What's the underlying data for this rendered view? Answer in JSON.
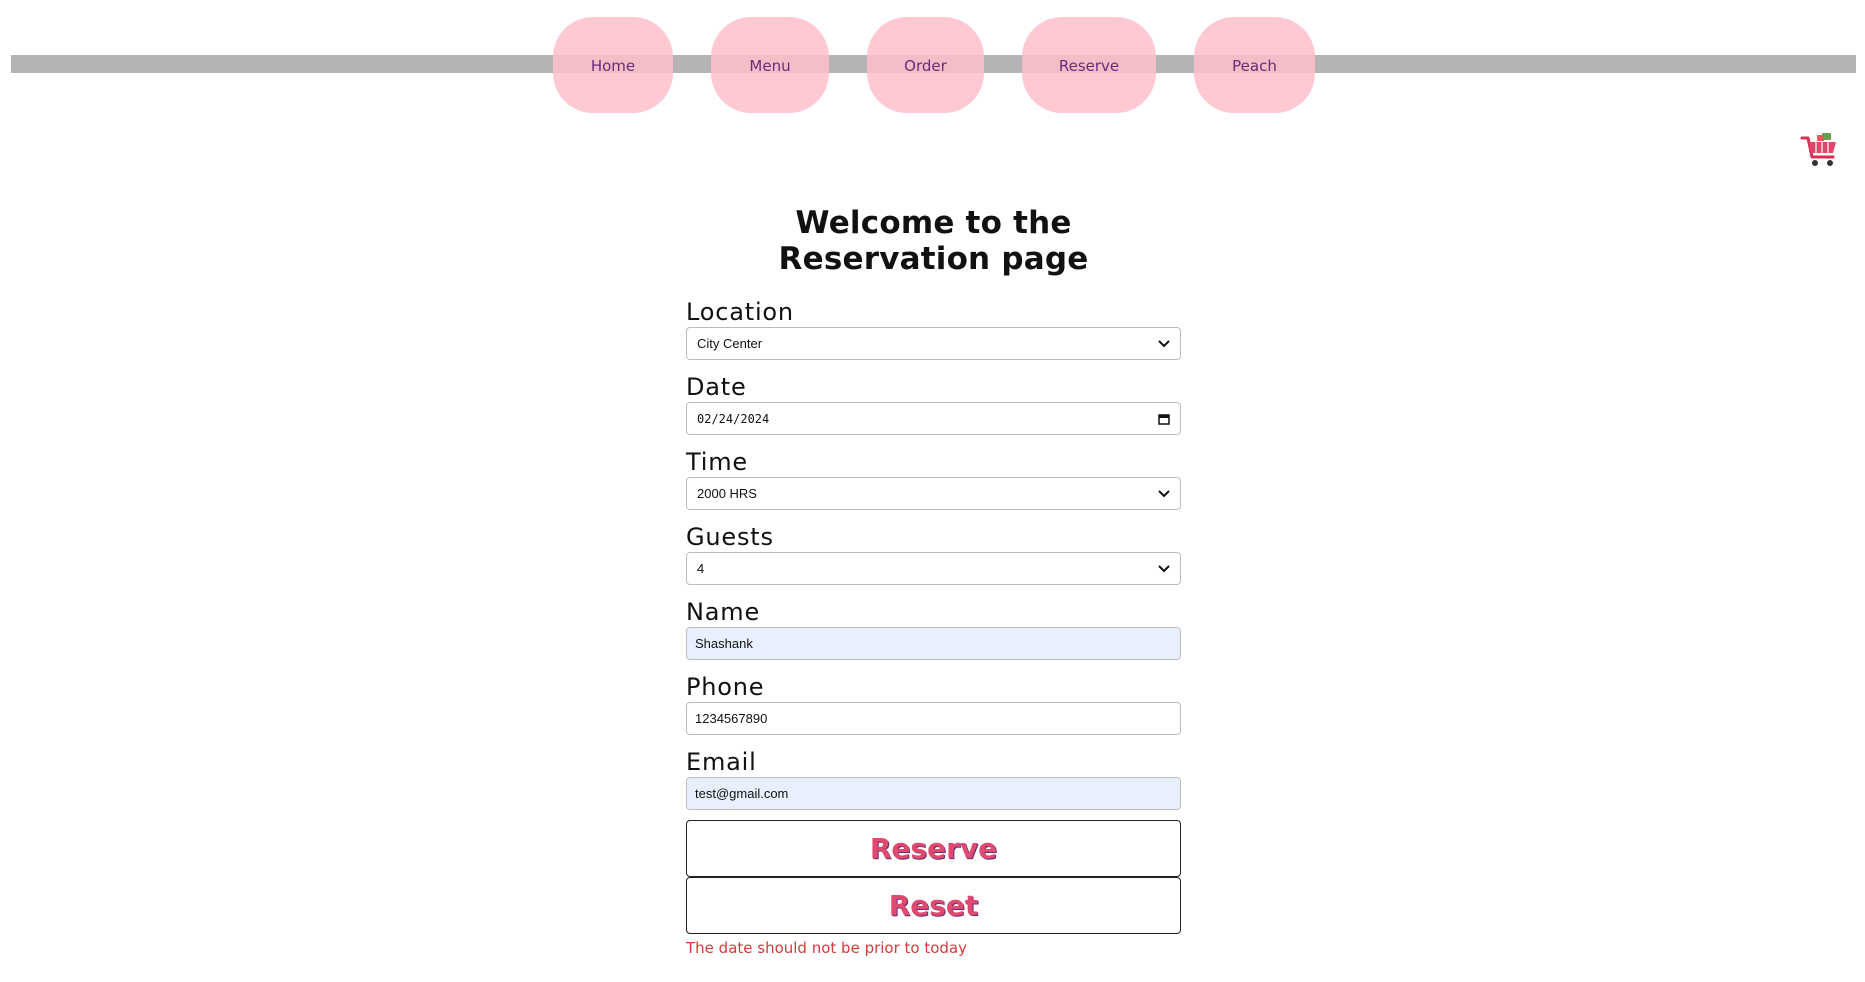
{
  "nav": {
    "items": [
      {
        "label": "Home"
      },
      {
        "label": "Menu"
      },
      {
        "label": "Order"
      },
      {
        "label": "Reserve"
      },
      {
        "label": "Peach"
      }
    ]
  },
  "cart": {
    "icon": "cart-icon"
  },
  "form": {
    "title": "Welcome to the Reservation page",
    "location": {
      "label": "Location",
      "value": "City Center"
    },
    "date": {
      "label": "Date",
      "value": "02/24/2024"
    },
    "time": {
      "label": "Time",
      "value": "2000 HRS"
    },
    "guests": {
      "label": "Guests",
      "value": "4"
    },
    "name": {
      "label": "Name",
      "value": "Shashank"
    },
    "phone": {
      "label": "Phone",
      "value": "1234567890"
    },
    "email": {
      "label": "Email",
      "value": "test@gmail.com"
    },
    "reserve_label": "Reserve",
    "reset_label": "Reset",
    "error": "The date should not be prior to today"
  },
  "colors": {
    "nav_pill": "#ffc0cb",
    "nav_bar": "#b4b4b4",
    "button_text": "#e04a6e",
    "error_text": "#d23c3c",
    "autofill_bg": "#e8f0fe"
  }
}
